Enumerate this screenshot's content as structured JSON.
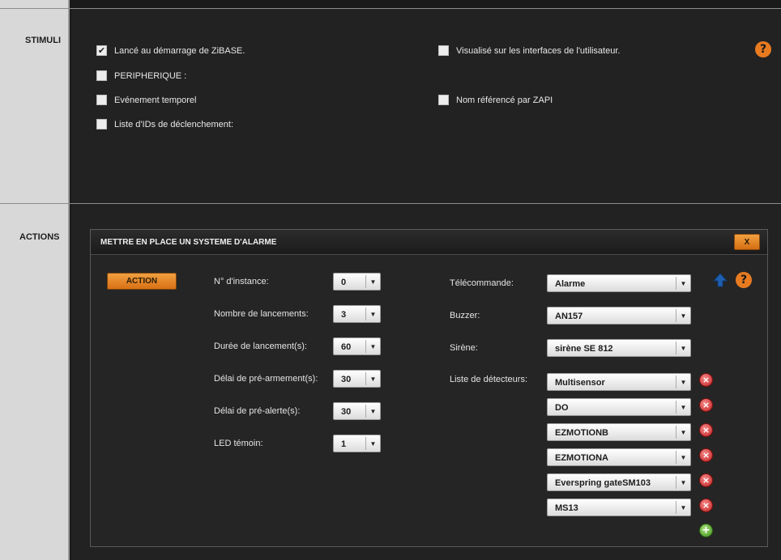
{
  "sections": {
    "stimuli": "STIMULI",
    "actions": "ACTIONS"
  },
  "stimuli": {
    "launch_at_startup": {
      "label": "Lancé au démarrage de ZiBASE.",
      "checked": true
    },
    "peripheral": {
      "label": "PERIPHERIQUE :",
      "checked": false
    },
    "time_event": {
      "label": "Evénement temporel",
      "checked": false
    },
    "trigger_ids": {
      "label": "Liste d'IDs de déclenchement:",
      "checked": false
    },
    "visible_on_ui": {
      "label": "Visualisé sur les interfaces de l'utilisateur.",
      "checked": false
    },
    "zapi_name": {
      "label": "Nom référencé par ZAPI",
      "checked": false
    },
    "help": "?"
  },
  "modal": {
    "title": "METTRE EN PLACE UN SYSTEME D'ALARME",
    "close_label": "X",
    "action_label": "ACTION",
    "help": "?",
    "fields": {
      "instance": {
        "label": "N° d'instance:",
        "value": "0"
      },
      "launches": {
        "label": "Nombre de lancements:",
        "value": "3"
      },
      "duration": {
        "label": "Durée de lancement(s):",
        "value": "60"
      },
      "prearm": {
        "label": "Délai de pré-armement(s):",
        "value": "30"
      },
      "prealert": {
        "label": "Délai de pré-alerte(s):",
        "value": "30"
      },
      "led": {
        "label": "LED témoin:",
        "value": "1"
      },
      "remote": {
        "label": "Télécommande:",
        "value": "Alarme"
      },
      "buzzer": {
        "label": "Buzzer:",
        "value": "AN157"
      },
      "siren": {
        "label": "Sirène:",
        "value": "sirène SE 812"
      },
      "detectors_label": "Liste de détecteurs:"
    },
    "detectors": [
      "Multisensor",
      "DO",
      "EZMOTIONB",
      "EZMOTIONA",
      "Everspring gateSM103",
      "MS13"
    ]
  },
  "icons": {
    "checkbox_mark": "✔",
    "dropdown": "▼",
    "remove": "×",
    "add": "+"
  },
  "colors": {
    "accent": "#e87a20",
    "panel": "#252525",
    "background": "#1a1a1a"
  }
}
